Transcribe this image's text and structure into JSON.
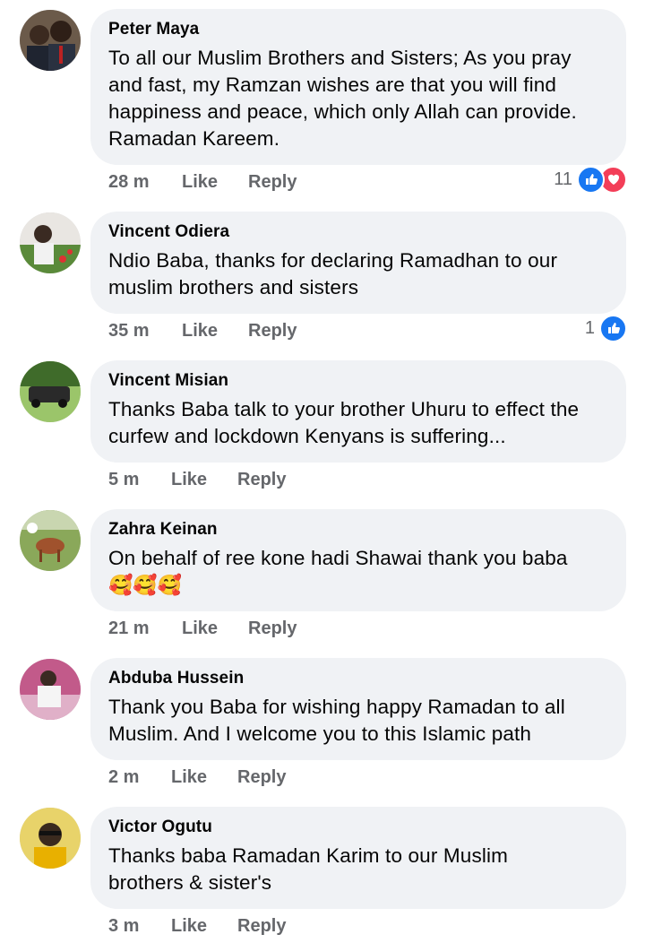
{
  "comments": [
    {
      "author": "Peter Maya",
      "text": "To all our Muslim Brothers and Sisters; As you pray\nand fast, my Ramzan wishes are that you will find\nhappiness and peace, which only Allah can provide.\nRamadan Kareem.",
      "time": "28 m",
      "like": "Like",
      "reply": "Reply",
      "reaction_count": "11",
      "reactions": [
        "like-icon",
        "love-icon"
      ]
    },
    {
      "author": "Vincent Odiera",
      "text": "Ndio Baba, thanks for declaring Ramadhan to our\nmuslim brothers and sisters",
      "time": "35 m",
      "like": "Like",
      "reply": "Reply",
      "reaction_count": "1",
      "reactions": [
        "like-icon"
      ]
    },
    {
      "author": "Vincent Misian",
      "text": "Thanks Baba talk to your brother Uhuru to effect the\ncurfew and lockdown Kenyans is suffering...",
      "time": "5 m",
      "like": "Like",
      "reply": "Reply"
    },
    {
      "author": "Zahra Keinan",
      "text": "On behalf of ree kone hadi Shawai thank you baba",
      "emoji": "🥰🥰🥰",
      "time": "21 m",
      "like": "Like",
      "reply": "Reply"
    },
    {
      "author": "Abduba Hussein",
      "text": "Thank you Baba for wishing happy Ramadan to all\nMuslim. And I welcome you to this Islamic path",
      "time": "2 m",
      "like": "Like",
      "reply": "Reply"
    },
    {
      "author": "Victor Ogutu",
      "text": "Thanks baba Ramadan Karim to our Muslim\nbrothers & sister's",
      "time": "3 m",
      "like": "Like",
      "reply": "Reply"
    }
  ],
  "colors": {
    "bubble": "#f0f2f5",
    "action_text": "#65676b",
    "like_reaction": "#1877f2",
    "love_reaction": "#f33e58"
  }
}
